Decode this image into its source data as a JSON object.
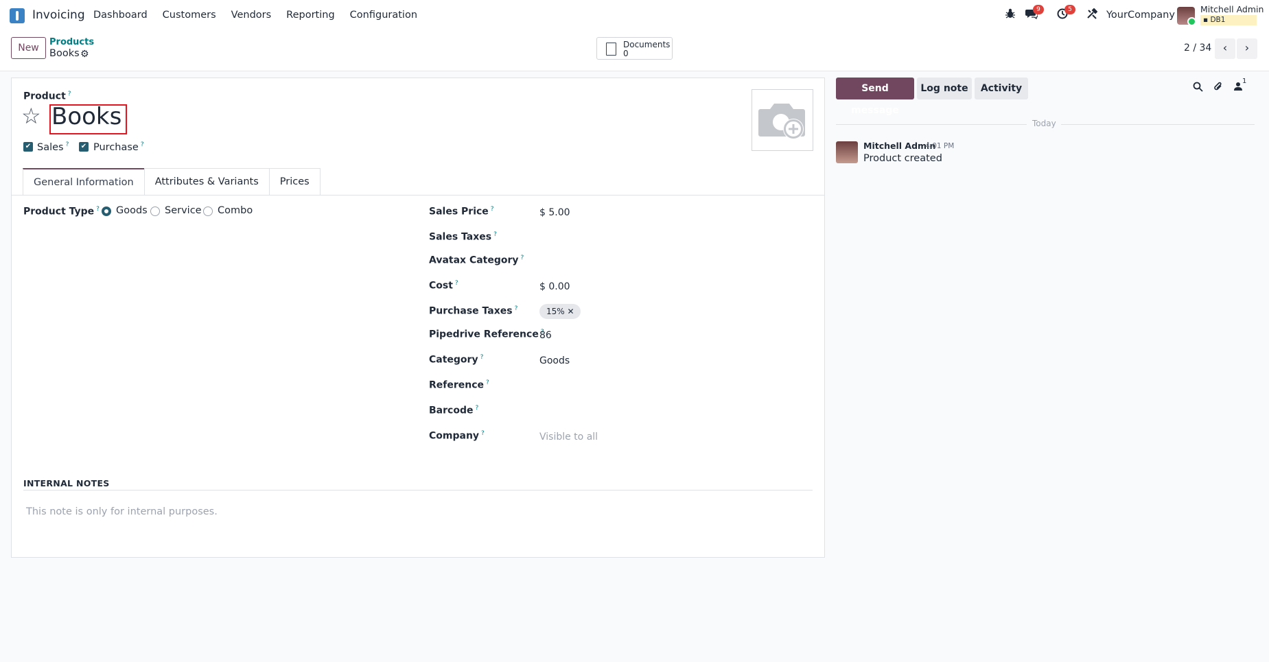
{
  "app": {
    "name": "Invoicing"
  },
  "menu": [
    "Dashboard",
    "Customers",
    "Vendors",
    "Reporting",
    "Configuration"
  ],
  "systray": {
    "messages_count": "9",
    "activities_count": "5",
    "company": "YourCompany",
    "user_name": "Mitchell Admin",
    "db": "DB1"
  },
  "control": {
    "new_label": "New",
    "breadcrumb_parent": "Products",
    "breadcrumb_current": "Books",
    "documents_label": "Documents",
    "documents_count": "0",
    "pager": "2 / 34"
  },
  "form": {
    "product_label": "Product",
    "name": "Books",
    "sales_label": "Sales",
    "purchase_label": "Purchase",
    "tabs": [
      "General Information",
      "Attributes & Variants",
      "Prices"
    ],
    "product_type_label": "Product Type",
    "product_type_options": [
      "Goods",
      "Service",
      "Combo"
    ],
    "product_type_selected": "Goods",
    "fields": {
      "sales_price": {
        "label": "Sales Price",
        "value": "$ 5.00"
      },
      "sales_taxes": {
        "label": "Sales Taxes",
        "value": ""
      },
      "avatax_category": {
        "label": "Avatax Category",
        "value": ""
      },
      "cost": {
        "label": "Cost",
        "value": "$ 0.00"
      },
      "purchase_taxes": {
        "label": "Purchase Taxes",
        "tag": "15%"
      },
      "pipedrive_reference": {
        "label": "Pipedrive Reference",
        "value": "86"
      },
      "category": {
        "label": "Category",
        "value": "Goods"
      },
      "reference": {
        "label": "Reference",
        "value": ""
      },
      "barcode": {
        "label": "Barcode",
        "value": ""
      },
      "company": {
        "label": "Company",
        "placeholder": "Visible to all"
      }
    },
    "notes_title": "INTERNAL NOTES",
    "notes_placeholder": "This note is only for internal purposes."
  },
  "chatter": {
    "send_message": "Send message",
    "log_note": "Log note",
    "activity": "Activity",
    "followers_count": "1",
    "divider": "Today",
    "messages": [
      {
        "author": "Mitchell Admin",
        "time": "4:01 PM",
        "body": "Product created"
      }
    ]
  },
  "colors": {
    "brand": "#71475f",
    "link": "#017e84",
    "check": "#275d71",
    "highlight": "#e4141e"
  }
}
